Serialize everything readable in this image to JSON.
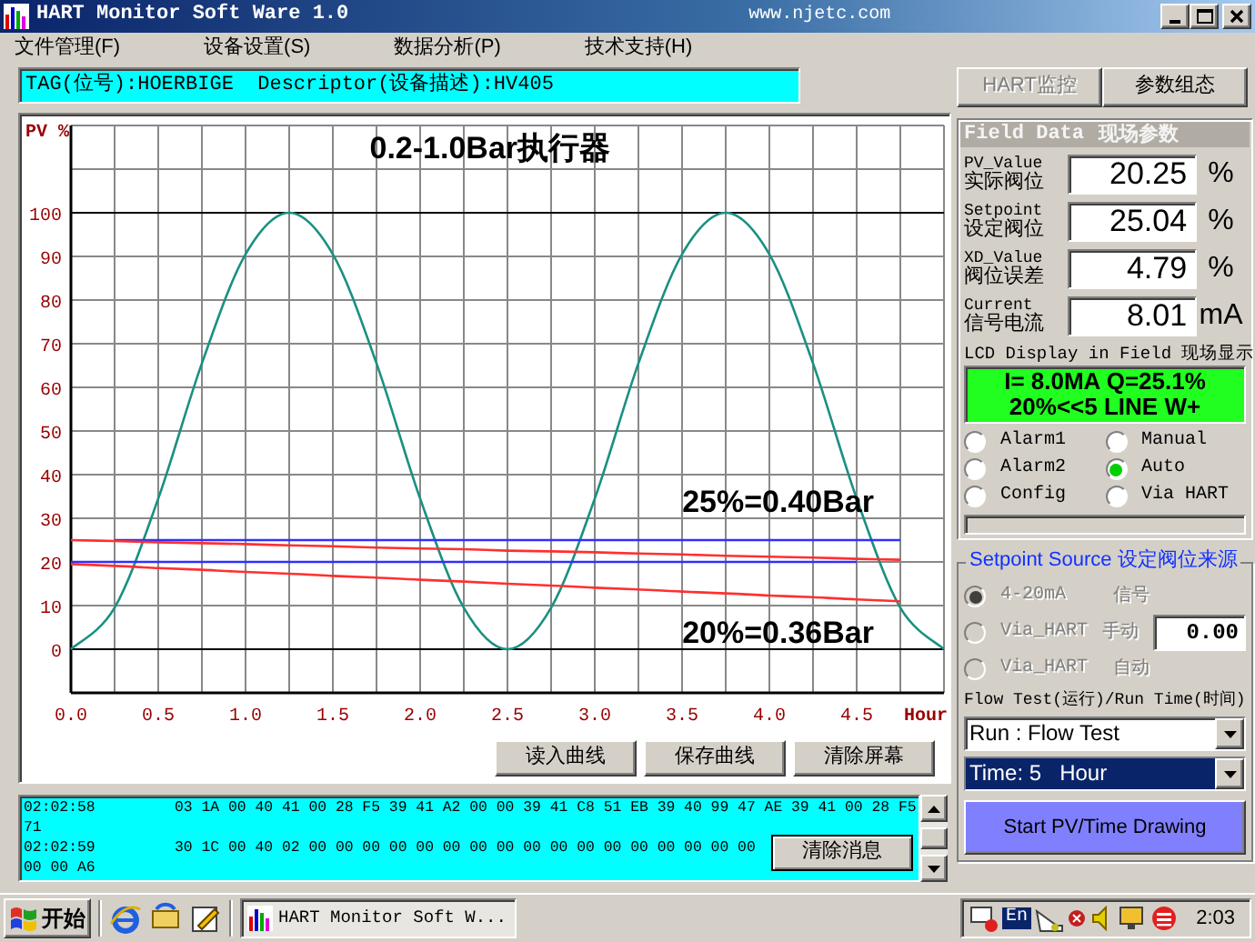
{
  "window": {
    "title": "HART Monitor Soft Ware 1.0",
    "url": "www.njetc.com"
  },
  "menu": [
    {
      "label": "文件管理(F)"
    },
    {
      "label": "设备设置(S)"
    },
    {
      "label": "数据分析(P)"
    },
    {
      "label": "技术支持(H)"
    }
  ],
  "tag_bar": "TAG(位号):HOERBIGE  Descriptor(设备描述):HV405",
  "mode_buttons": [
    {
      "label": "HART监控",
      "disabled": true
    },
    {
      "label": "参数组态",
      "disabled": false
    }
  ],
  "chart": {
    "chart_data": {
      "type": "line",
      "title": "0.2-1.0Bar执行器",
      "xlabel": "Hour",
      "ylabel": "PV %",
      "x": [
        0,
        0.25,
        0.5,
        0.75,
        1,
        1.25,
        1.5,
        1.75,
        2,
        2.25,
        2.5,
        2.75,
        3,
        3.25,
        3.5,
        3.75,
        4,
        4.25,
        4.5,
        4.75,
        5
      ],
      "series": [
        {
          "color": "#1a9080",
          "values": [
            0,
            9.5,
            34.5,
            65.5,
            90.5,
            100,
            90.5,
            65.5,
            34.5,
            9.5,
            0,
            9.5,
            34.5,
            65.5,
            90.5,
            100,
            90.5,
            65.5,
            34.5,
            9.5,
            0
          ]
        },
        {
          "color": "#3030ff",
          "values": [
            null,
            25,
            25,
            25,
            25,
            25,
            25,
            25,
            25,
            25,
            25,
            25,
            25,
            25,
            25,
            25,
            25,
            25,
            25,
            25,
            null
          ]
        },
        {
          "color": "#3030ff",
          "values": [
            20,
            20,
            20,
            20,
            20,
            20,
            20,
            20,
            20,
            20,
            20,
            20,
            20,
            20,
            20,
            20,
            20,
            20,
            20,
            null,
            null
          ]
        },
        {
          "color": "#ff3030",
          "values": [
            25,
            24.8,
            24.5,
            24.3,
            24.1,
            23.8,
            23.6,
            23.3,
            23.1,
            22.9,
            22.6,
            22.4,
            22.2,
            21.9,
            21.7,
            21.4,
            21.2,
            21,
            20.7,
            20.5,
            null
          ]
        },
        {
          "color": "#ff3030",
          "values": [
            19.5,
            19.1,
            18.6,
            18.2,
            17.7,
            17.3,
            16.8,
            16.4,
            15.9,
            15.5,
            15,
            14.6,
            14.1,
            13.7,
            13.2,
            12.8,
            12.3,
            11.9,
            11.4,
            11,
            null
          ]
        }
      ],
      "xlim": [
        0,
        5
      ],
      "ylim": [
        -10,
        120
      ],
      "xticks": [
        {
          "value": 0,
          "label": "0.0"
        },
        {
          "value": 0.5,
          "label": "0.5"
        },
        {
          "value": 1,
          "label": "1.0"
        },
        {
          "value": 1.5,
          "label": "1.5"
        },
        {
          "value": 2,
          "label": "2.0"
        },
        {
          "value": 2.5,
          "label": "2.5"
        },
        {
          "value": 3,
          "label": "3.0"
        },
        {
          "value": 3.5,
          "label": "3.5"
        },
        {
          "value": 4,
          "label": "4.0"
        },
        {
          "value": 4.5,
          "label": "4.5"
        }
      ],
      "yticks": [
        0,
        10,
        20,
        30,
        40,
        50,
        60,
        70,
        80,
        90,
        100
      ],
      "grid": true,
      "annotations": [
        "25%=0.40Bar",
        "20%=0.36Bar"
      ]
    }
  },
  "chart_buttons": [
    "读入曲线",
    "保存曲线",
    "清除屏幕"
  ],
  "message_log": {
    "rows": [
      {
        "time": "02:02:58",
        "data": "03 1A 00 40 41 00 28 F5 39 41 A2 00 00 39 41 C8 51 EB 39 40 99 47 AE 39 41 00 28 F5",
        "wrap": "71"
      },
      {
        "time": "02:02:59",
        "data": "30 1C 00 40 02 00 00 00 00 00 00 00 00 00 00 00 00 00 00 00 00 00",
        "wrap": "00 00 A6"
      }
    ],
    "clear_button": "清除消息"
  },
  "field_data": {
    "title": "Field Data",
    "title_cn": "现场参数",
    "readings": [
      {
        "label": "PV_Value",
        "label_cn": "实际阀位",
        "value": "20.25",
        "unit": "%"
      },
      {
        "label": "Setpoint",
        "label_cn": "设定阀位",
        "value": "25.04",
        "unit": "%"
      },
      {
        "label": "XD_Value",
        "label_cn": "阀位误差",
        "value": "4.79",
        "unit": "%"
      },
      {
        "label": "Current",
        "label_cn": "信号电流",
        "value": "8.01",
        "unit": "mA"
      }
    ],
    "lcd_title": "LCD Display in Field 现场显示",
    "lcd_lines": [
      "I= 8.0MA Q=25.1%",
      "20%<<5  LINE W+"
    ],
    "indicators": [
      {
        "label": "Alarm1",
        "selected": false
      },
      {
        "label": "Manual",
        "selected": false
      },
      {
        "label": "Alarm2",
        "selected": false
      },
      {
        "label": "Auto",
        "selected": true
      },
      {
        "label": "Config",
        "selected": false
      },
      {
        "label": "Via HART",
        "selected": false
      }
    ]
  },
  "setpoint_source": {
    "title": "Setpoint Source 设定阀位来源",
    "options": [
      {
        "label": "4-20mA",
        "label_cn": "信号",
        "selected": true,
        "disabled": true
      },
      {
        "label": "Via_HART",
        "label_cn": "手动",
        "selected": false,
        "disabled": true
      },
      {
        "label": "Via_HART",
        "label_cn": "自动",
        "selected": false,
        "disabled": true
      }
    ],
    "value": "0.00",
    "run_label": "Flow Test(运行)/Run Time(时间)",
    "dropdowns": [
      {
        "value": "Run : Flow Test",
        "focused": false
      },
      {
        "value": "Time: 5   Hour",
        "focused": true
      }
    ],
    "start_button": "Start PV/Time Drawing"
  },
  "taskbar": {
    "start": "开始",
    "task": "HART Monitor Soft W...",
    "language": "En",
    "clock": "2:03"
  }
}
